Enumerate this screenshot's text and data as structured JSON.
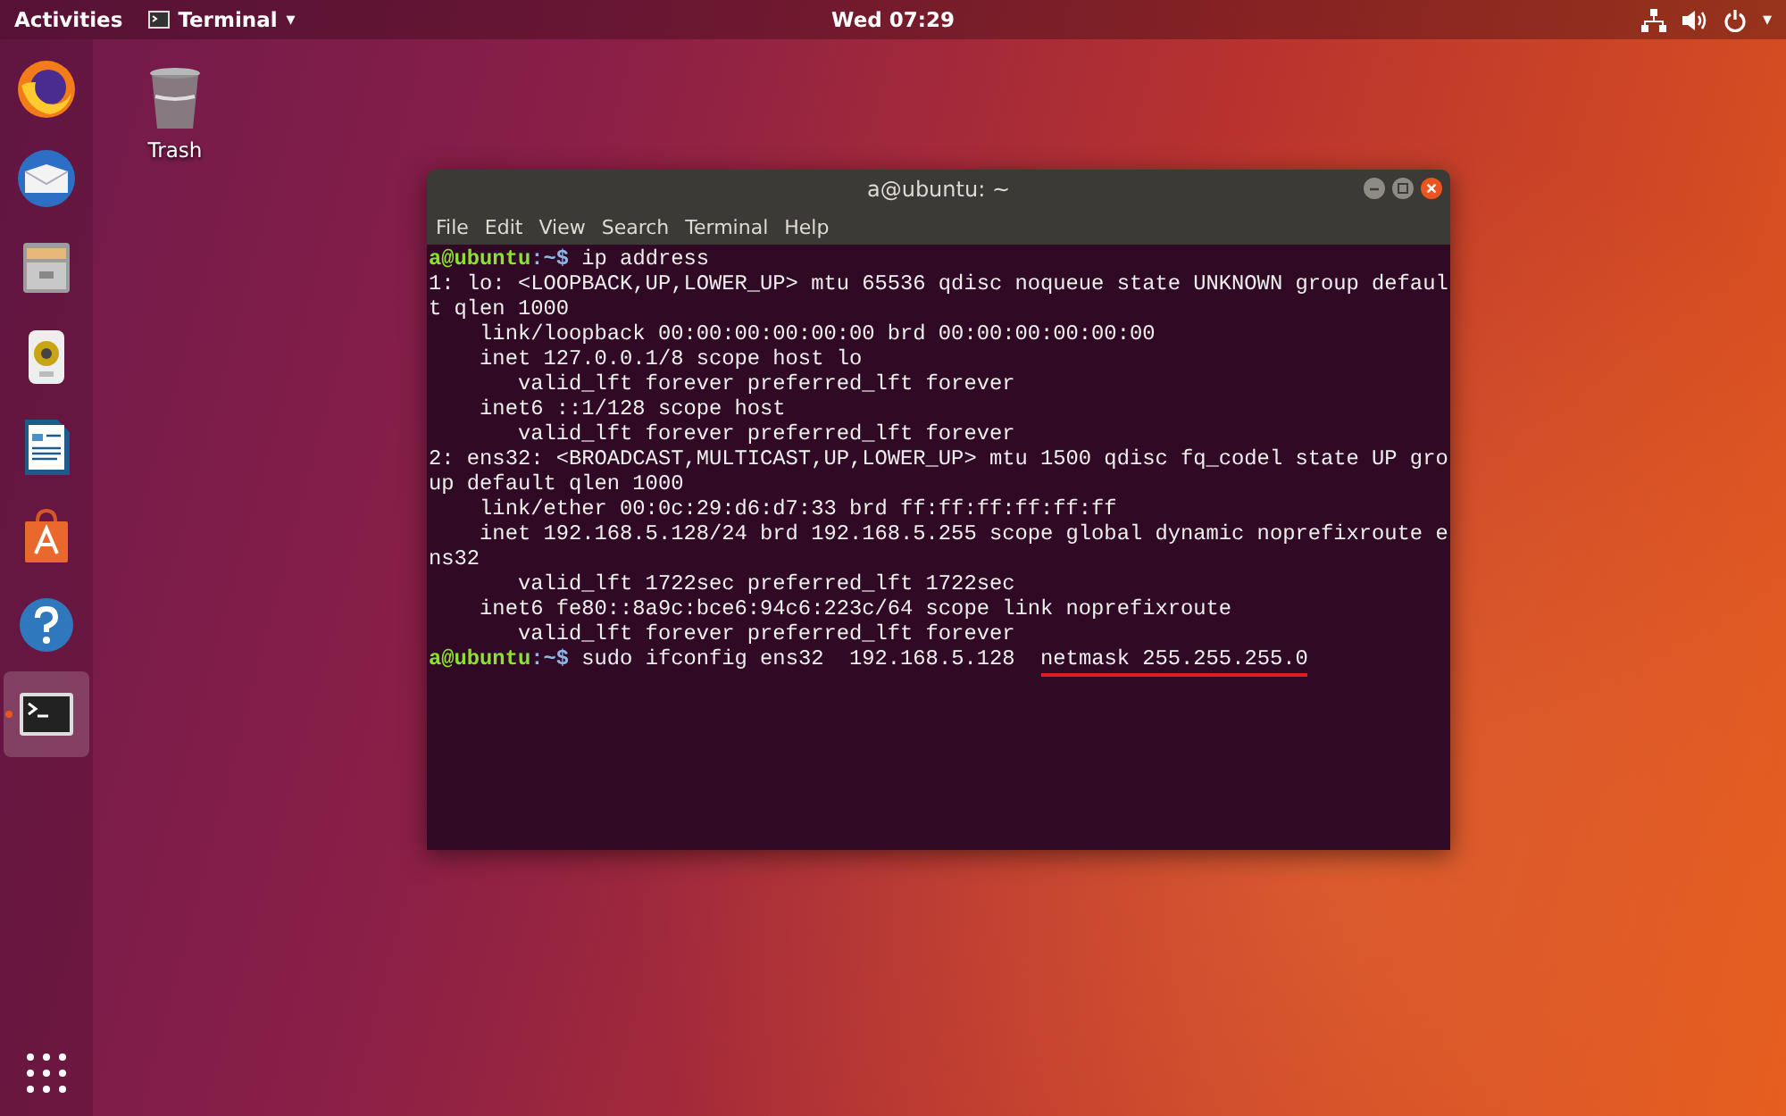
{
  "top_bar": {
    "activities": "Activities",
    "app_menu": {
      "label": "Terminal",
      "caret": "▾"
    },
    "clock": "Wed 07:29",
    "status_caret": "▾"
  },
  "dock": {
    "items": [
      {
        "kind": "browser",
        "active": false
      },
      {
        "kind": "mail",
        "active": false
      },
      {
        "kind": "file-cabinet",
        "active": false
      },
      {
        "kind": "speaker",
        "active": false
      },
      {
        "kind": "document",
        "active": false
      },
      {
        "kind": "shopping-bag",
        "active": false
      },
      {
        "kind": "help",
        "active": false
      },
      {
        "kind": "terminal",
        "active": true
      }
    ]
  },
  "desktop_icons": [
    {
      "label": "Trash"
    }
  ],
  "terminal_window": {
    "title": "a@ubuntu: ~",
    "menu": [
      "File",
      "Edit",
      "View",
      "Search",
      "Terminal",
      "Help"
    ],
    "lines": [
      {
        "kind": "prompt",
        "user": "a@ubuntu",
        "path": ":~$",
        "command": [
          {
            "text": " ip address",
            "underlined": false
          }
        ]
      },
      {
        "kind": "output",
        "text": "1: lo: <LOOPBACK,UP,LOWER_UP> mtu 65536 qdisc noqueue state UNKNOWN group defaul"
      },
      {
        "kind": "output",
        "text": "t qlen 1000"
      },
      {
        "kind": "output",
        "text": "    link/loopback 00:00:00:00:00:00 brd 00:00:00:00:00:00"
      },
      {
        "kind": "output",
        "text": "    inet 127.0.0.1/8 scope host lo"
      },
      {
        "kind": "output",
        "text": "       valid_lft forever preferred_lft forever"
      },
      {
        "kind": "output",
        "text": "    inet6 ::1/128 scope host"
      },
      {
        "kind": "output",
        "text": "       valid_lft forever preferred_lft forever"
      },
      {
        "kind": "output",
        "text": "2: ens32: <BROADCAST,MULTICAST,UP,LOWER_UP> mtu 1500 qdisc fq_codel state UP gro"
      },
      {
        "kind": "output",
        "text": "up default qlen 1000"
      },
      {
        "kind": "output",
        "text": "    link/ether 00:0c:29:d6:d7:33 brd ff:ff:ff:ff:ff:ff"
      },
      {
        "kind": "output",
        "text": "    inet 192.168.5.128/24 brd 192.168.5.255 scope global dynamic noprefixroute e"
      },
      {
        "kind": "output",
        "text": "ns32"
      },
      {
        "kind": "output",
        "text": "       valid_lft 1722sec preferred_lft 1722sec"
      },
      {
        "kind": "output",
        "text": "    inet6 fe80::8a9c:bce6:94c6:223c/64 scope link noprefixroute"
      },
      {
        "kind": "output",
        "text": "       valid_lft forever preferred_lft forever"
      },
      {
        "kind": "prompt",
        "user": "a@ubuntu",
        "path": ":~$",
        "command": [
          {
            "text": " sudo ifconfig ens32  192.168.5.128  ",
            "underlined": false
          },
          {
            "text": "netmask 255.255.255.0",
            "underlined": true
          }
        ]
      }
    ]
  }
}
